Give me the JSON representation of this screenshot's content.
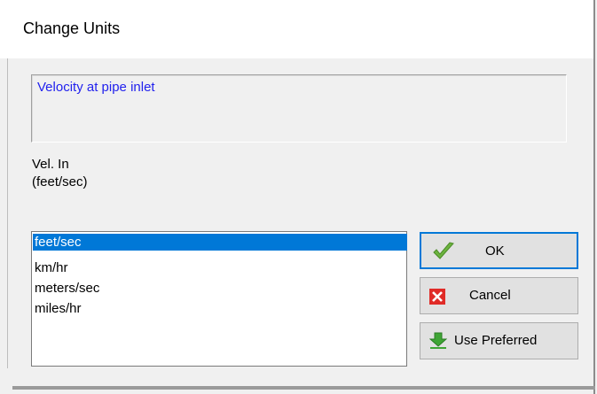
{
  "dialog": {
    "title": "Change Units",
    "description": "Velocity at pipe inlet",
    "parameter_label": "Vel. In",
    "parameter_unit": "(feet/sec)"
  },
  "units_list": {
    "items": [
      "feet/sec",
      "km/hr",
      "meters/sec",
      "miles/hr"
    ],
    "selected": "feet/sec"
  },
  "buttons": {
    "ok": "OK",
    "cancel": "Cancel",
    "use_preferred": "Use Preferred"
  },
  "colors": {
    "selection": "#0078d7",
    "description_text": "#2222ee",
    "check_icon": "#6cb33f",
    "cancel_icon": "#e02b27",
    "preferred_icon": "#3fa535"
  },
  "icons": {
    "ok": "check-icon",
    "cancel": "red-x-icon",
    "use_preferred": "green-down-arrow-icon"
  }
}
